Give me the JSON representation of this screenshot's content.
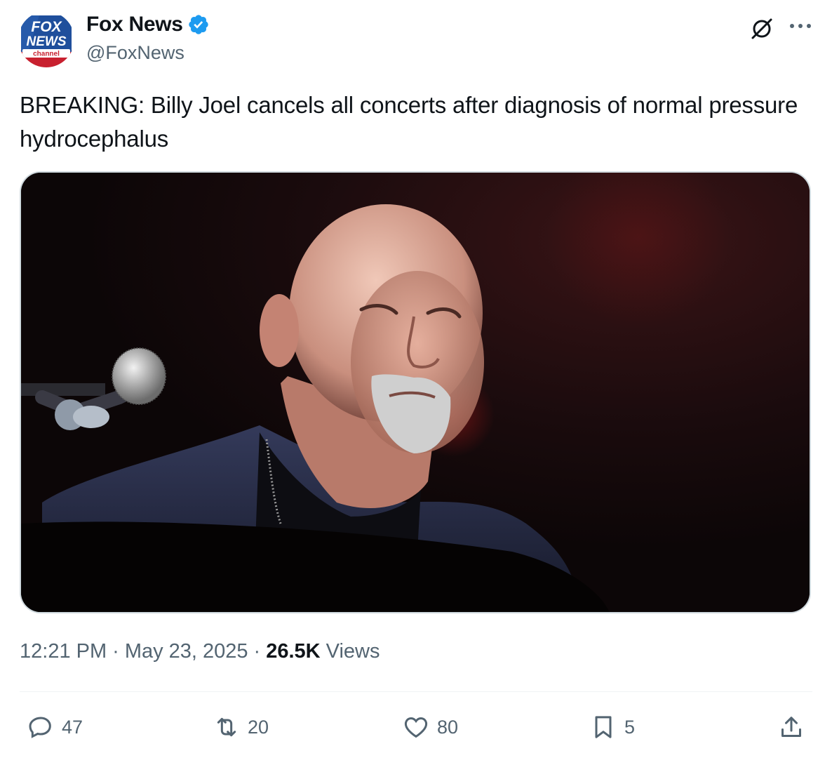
{
  "tweet": {
    "display_name": "Fox News",
    "handle": "@FoxNews",
    "text": "BREAKING: Billy Joel cancels all concerts after diagnosis of normal pressure hydrocephalus",
    "logo_text": {
      "fox": "FOX",
      "news": "NEWS",
      "channel": "channel"
    }
  },
  "meta": {
    "time": "12:21 PM",
    "separator1": "·",
    "date": "May 23, 2025",
    "separator2": "·",
    "views_count": "26.5K",
    "views_label": "Views"
  },
  "actions": {
    "replies": "47",
    "reposts": "20",
    "likes": "80",
    "bookmarks": "5"
  },
  "icons": {
    "verified": "verified-badge-icon",
    "grok": "grok-icon",
    "more": "more-icon",
    "reply": "reply-icon",
    "repost": "repost-icon",
    "like": "heart-icon",
    "bookmark": "bookmark-icon",
    "share": "share-icon"
  },
  "colors": {
    "verified_blue": "#1d9bf0",
    "text_primary": "#0f1419",
    "text_secondary": "#536471",
    "fox_blue": "#1f4f9c",
    "fox_red": "#c8202f"
  }
}
